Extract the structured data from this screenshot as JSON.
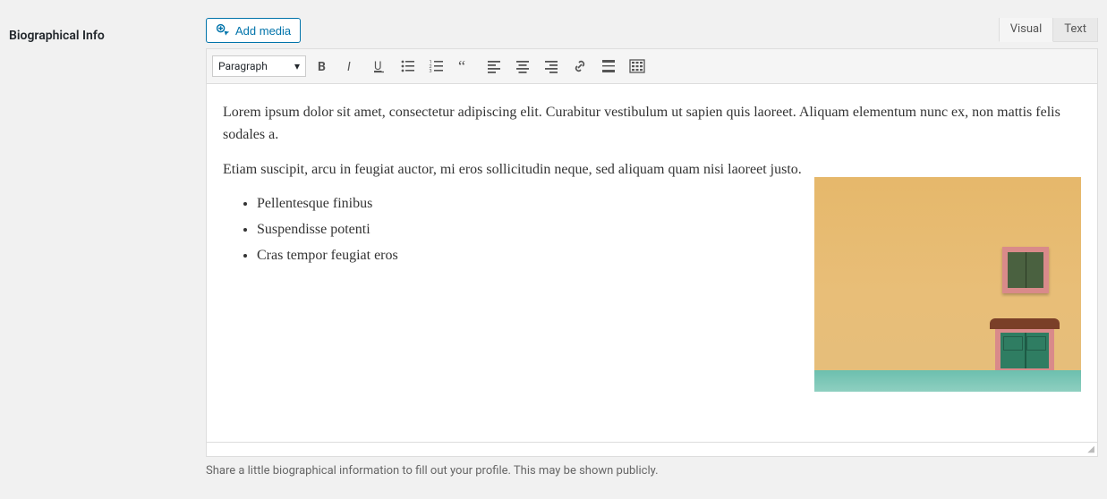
{
  "field_label": "Biographical Info",
  "add_media_label": "Add media",
  "tabs": {
    "visual": "Visual",
    "text": "Text",
    "active": "visual"
  },
  "toolbar": {
    "format_selected": "Paragraph"
  },
  "content": {
    "p1": "Lorem ipsum dolor sit amet, consectetur adipiscing elit. Curabitur vestibulum ut sapien quis laoreet. Aliquam elementum nunc ex, non mattis felis sodales a.",
    "p2": "Etiam suscipit, arcu in feugiat auctor, mi eros sollicitudin neque, sed aliquam quam nisi laoreet justo.",
    "bullets": [
      "Pellentesque finibus",
      "Suspendisse potenti",
      "Cras tempor feugiat eros"
    ]
  },
  "description": "Share a little biographical information to fill out your profile. This may be shown publicly."
}
